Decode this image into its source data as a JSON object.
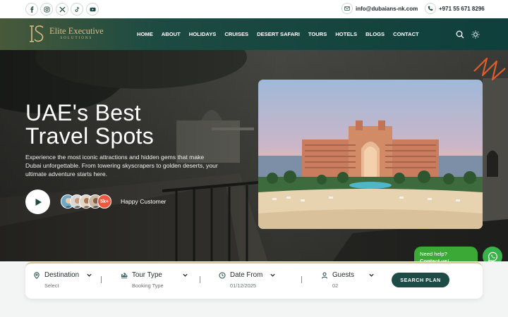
{
  "topbar": {
    "social_icons": [
      "facebook-icon",
      "instagram-icon",
      "x-icon",
      "tiktok-icon",
      "youtube-icon"
    ],
    "email": "info@dubaians-nk.com",
    "phone": "+971 55 671 8296"
  },
  "brand": {
    "name": "Elite Executive",
    "tagline": "SOLUTIONS",
    "colors": {
      "gold": "#d9bd86",
      "dark_green": "#1d4b45",
      "whatsapp_green": "#3aa935"
    }
  },
  "nav": {
    "items": [
      "HOME",
      "ABOUT",
      "HOLIDAYS",
      "CRUISES",
      "DESERT SAFARI",
      "TOURS",
      "HOTELS",
      "BLOGS",
      "CONTACT"
    ]
  },
  "hero": {
    "title_line1": "UAE's Best",
    "title_line2": "Travel Spots",
    "description": "Experience the most iconic attractions and hidden gems that make Dubai unforgettable. From towering skyscrapers to golden deserts, your ultimate adventure starts here.",
    "customers_badge": "5k+",
    "customers_label": "Happy Customer"
  },
  "search": {
    "fields": [
      {
        "label": "Destination",
        "value": "Select"
      },
      {
        "label": "Tour Type",
        "value": "Booking Type"
      },
      {
        "label": "Date From",
        "value": "01/12/2025"
      },
      {
        "label": "Guests",
        "value": "02"
      }
    ],
    "button": "SEARCH PLAN"
  },
  "help": {
    "line1": "Need help?",
    "line2": "Contact us!"
  }
}
